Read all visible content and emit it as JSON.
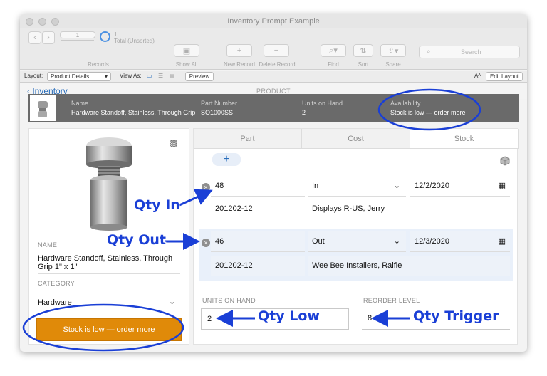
{
  "window": {
    "title": "Inventory Prompt Example"
  },
  "toolbar": {
    "record_number": "1",
    "total": "Total (Unsorted)",
    "records_label": "Records",
    "show_all": "Show All",
    "new_record": "New Record",
    "delete_record": "Delete Record",
    "find": "Find",
    "sort": "Sort",
    "share": "Share",
    "search_placeholder": "Search"
  },
  "layoutbar": {
    "layout_label": "Layout:",
    "layout_value": "Product Details",
    "view_as": "View As:",
    "preview": "Preview",
    "edit_layout": "Edit Layout",
    "text_size": "Aᴬ"
  },
  "nav": {
    "back": "Inventory",
    "title": "PRODUCT"
  },
  "summary": {
    "name_label": "Name",
    "name_value": "Hardware Standoff, Stainless, Through Grip",
    "part_label": "Part Number",
    "part_value": "SO1000SS",
    "units_label": "Units on Hand",
    "units_value": "2",
    "avail_label": "Availability",
    "avail_value": "Stock is low — order more"
  },
  "left": {
    "name_label": "NAME",
    "name_line1": "Hardware Standoff, Stainless, Through",
    "name_line2": "Grip 1\" x 1\"",
    "category_label": "CATEGORY",
    "category_value": "Hardware",
    "order_button": "Stock is low — order more"
  },
  "tabs": [
    "Part",
    "Cost",
    "Stock"
  ],
  "transactions": [
    {
      "qty": "48",
      "type": "In",
      "date": "12/2/2020",
      "ref": "201202-12",
      "party": "Displays R-US, Jerry"
    },
    {
      "qty": "46",
      "type": "Out",
      "date": "12/3/2020",
      "ref": "201202-12",
      "party": "Wee Bee Installers, Ralfie"
    }
  ],
  "stock": {
    "units_label": "UNITS ON HAND",
    "units_value": "2",
    "reorder_label": "REORDER LEVEL",
    "reorder_value": "8"
  },
  "annotations": {
    "qty_in": "Qty In",
    "qty_out": "Qty Out",
    "qty_low": "Qty Low",
    "qty_trigger": "Qty Trigger"
  },
  "colors": {
    "accent": "#2a6ebb",
    "order_button": "#e08a09",
    "annotation": "#1a3fd6",
    "summary_bar": "#6a6a6a"
  }
}
